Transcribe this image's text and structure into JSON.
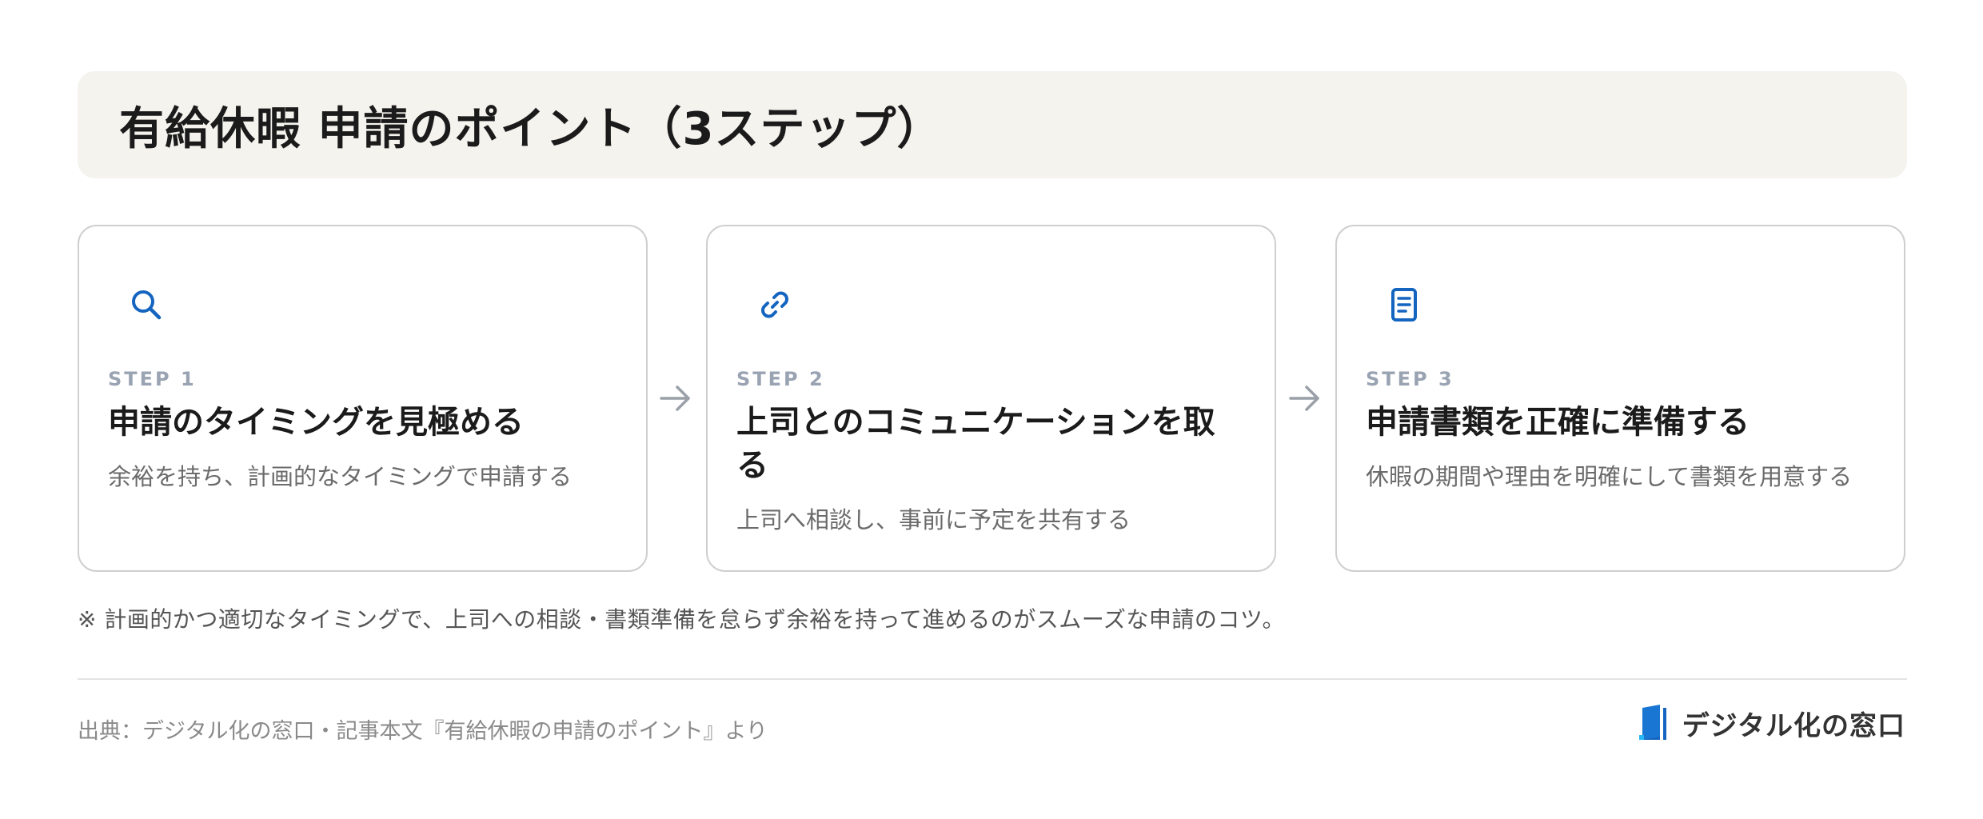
{
  "header": {
    "title": "有給休暇 申請のポイント（3ステップ）"
  },
  "steps": [
    {
      "label": "STEP 1",
      "icon": "search-icon",
      "title": "申請のタイミングを見極める",
      "desc": "余裕を持ち、計画的なタイミングで申請する"
    },
    {
      "label": "STEP 2",
      "icon": "link-icon",
      "title": "上司とのコミュニケーションを取る",
      "desc": "上司へ相談し、事前に予定を共有する"
    },
    {
      "label": "STEP 3",
      "icon": "document-icon",
      "title": "申請書類を正確に準備する",
      "desc": "休暇の期間や理由を明確にして書類を用意する"
    }
  ],
  "note": "※ 計画的かつ適切なタイミングで、上司への相談・書類準備を怠らず余裕を持って進めるのがスムーズな申請のコツ。",
  "footer": {
    "source": "出典：デジタル化の窓口・記事本文『有給休暇の申請のポイント』より",
    "brand": "デジタル化の窓口"
  },
  "colors": {
    "accent": "#1565c0",
    "title_band": "#f5f3ee",
    "step_label": "#9aa3b2",
    "arrow": "#9aa0a8"
  }
}
